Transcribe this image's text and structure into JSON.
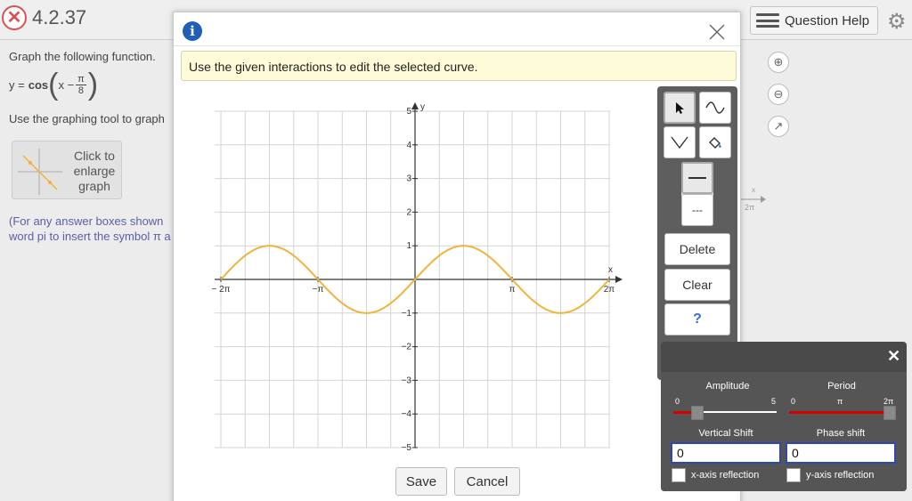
{
  "question": {
    "number": "4.2.37",
    "instruction": "Graph the following function.",
    "function_lhs": "y =",
    "function_name": "cos",
    "function_arg_var": "x −",
    "function_frac_num": "π",
    "function_frac_den": "8",
    "tool_instruction": "Use the graphing tool to graph",
    "enlarge_label": "Click to enlarge graph",
    "note": "(For any answer boxes shown",
    "note_line2": "word pi to insert the symbol π a"
  },
  "header": {
    "help_label": "Question Help"
  },
  "modal": {
    "banner": "Use the given interactions to edit the selected curve.",
    "save_label": "Save",
    "cancel_label": "Cancel"
  },
  "toolbar": {
    "delete_label": "Delete",
    "clear_label": "Clear",
    "help_label": "?",
    "dashed_label": "---",
    "tools": [
      "pointer-tool",
      "sine-tool",
      "parabola-tool",
      "fill-tool"
    ]
  },
  "properties": {
    "amplitude_label": "Amplitude",
    "amplitude_min": "0",
    "amplitude_max": "5",
    "period_label": "Period",
    "period_ticks": [
      "0",
      "π",
      "2π"
    ],
    "vertical_shift_label": "Vertical Shift",
    "vertical_shift_value": "0",
    "phase_shift_label": "Phase shift",
    "phase_shift_value": "0",
    "x_reflection_label": "x-axis reflection",
    "y_reflection_label": "y-axis reflection"
  },
  "graph": {
    "x_axis_label": "x",
    "y_axis_label": "y",
    "x_tick_labels": [
      "− 2π",
      "−π",
      "π",
      "2π"
    ],
    "y_tick_labels": [
      "5",
      "4",
      "3",
      "2",
      "1",
      "−1",
      "−2",
      "−3",
      "−4",
      "−5"
    ],
    "curve_color": "#f0b43c",
    "bg_x_label": "x",
    "bg_tick_label": "2π"
  },
  "chart_data": {
    "type": "line",
    "function": "y = sin(x)",
    "xlim": [
      -6.5,
      6.5
    ],
    "ylim": [
      -5,
      5
    ],
    "x_ticks": [
      -6.283,
      -3.1416,
      3.1416,
      6.283
    ],
    "y_ticks": [
      -5,
      -4,
      -3,
      -2,
      -1,
      1,
      2,
      3,
      4,
      5
    ],
    "grid": true,
    "series": [
      {
        "x": [
          -6.283,
          -4.712,
          -3.1416,
          -1.5708,
          0,
          1.5708,
          3.1416,
          4.712,
          6.283
        ],
        "y": [
          0,
          1,
          0,
          -1,
          0,
          1,
          0,
          -1,
          0
        ]
      }
    ]
  }
}
